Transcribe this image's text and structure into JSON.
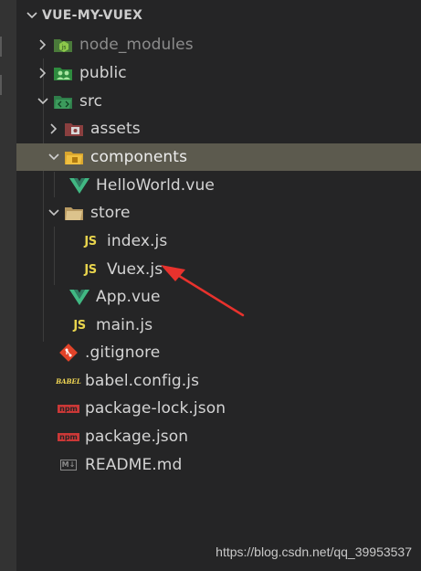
{
  "explorer": {
    "title": "VUE-MY-VUEX",
    "items": [
      {
        "label": "node_modules",
        "type": "folder",
        "expanded": false,
        "icon": "node-folder-icon"
      },
      {
        "label": "public",
        "type": "folder",
        "expanded": false,
        "icon": "public-folder-icon"
      },
      {
        "label": "src",
        "type": "folder",
        "expanded": true,
        "icon": "src-folder-icon"
      },
      {
        "label": "assets",
        "type": "folder",
        "expanded": false,
        "icon": "assets-folder-icon"
      },
      {
        "label": "components",
        "type": "folder",
        "expanded": true,
        "selected": true,
        "icon": "components-folder-icon"
      },
      {
        "label": "HelloWorld.vue",
        "type": "file",
        "icon": "vue-icon"
      },
      {
        "label": "store",
        "type": "folder",
        "expanded": true,
        "icon": "folder-open-icon"
      },
      {
        "label": "index.js",
        "type": "file",
        "icon": "js-icon"
      },
      {
        "label": "Vuex.js",
        "type": "file",
        "icon": "js-icon"
      },
      {
        "label": "App.vue",
        "type": "file",
        "icon": "vue-icon"
      },
      {
        "label": "main.js",
        "type": "file",
        "icon": "js-icon"
      },
      {
        "label": ".gitignore",
        "type": "file",
        "icon": "git-icon"
      },
      {
        "label": "babel.config.js",
        "type": "file",
        "icon": "babel-icon"
      },
      {
        "label": "package-lock.json",
        "type": "file",
        "icon": "npm-icon"
      },
      {
        "label": "package.json",
        "type": "file",
        "icon": "npm-icon"
      },
      {
        "label": "README.md",
        "type": "file",
        "icon": "markdown-icon"
      }
    ]
  },
  "icons": {
    "js_text": "JS",
    "babel_text": "BABEL",
    "npm_text": "npm",
    "markdown_text": "M↓"
  },
  "colors": {
    "background": "#252526",
    "selected_row": "#5c5a4e",
    "text": "#d4d4d4",
    "js_yellow": "#e8d44d",
    "vue_green": "#41b883",
    "arrow_red": "#e8322d"
  },
  "watermark": "https://blog.csdn.net/qq_39953537"
}
